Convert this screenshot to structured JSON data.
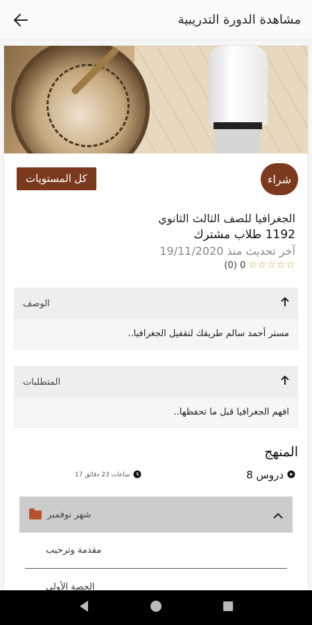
{
  "appbar": {
    "title": "مشاهدة الدورة التدريبية",
    "back_icon": "arrow-left-icon"
  },
  "course": {
    "levels_label": "كل المستويات",
    "buy_label": "شراء",
    "title": "الجغرافيا للصف الثالث الثانوي",
    "students": "1192 طلاب مشترك",
    "updated": "آخر تحديث منذ 19/11/2020",
    "rating_text": "0 (0)",
    "stars": "☆☆☆☆☆"
  },
  "description": {
    "label": "الوصف",
    "body": "مستر أحمد سالم طريقك لتقفيل الجغرافيا..",
    "icon": "arrow-up-icon"
  },
  "requirements": {
    "label": "المتطلبات",
    "body": "افهم الجغرافيا قبل ما تحفظها..",
    "icon": "arrow-up-icon"
  },
  "curriculum": {
    "title": "المنهج",
    "lessons": "8 دروس",
    "duration": "17 ساعات 23 دقائق",
    "section": {
      "title": "شهر نوفمبر",
      "icon": "folder-icon",
      "items": [
        "مقدمة وترحيب",
        "الحصة الأولى"
      ]
    }
  },
  "colors": {
    "accent": "#7b3a1e",
    "folder": "#b8522e"
  },
  "navbar": {
    "back": "nav-back-icon",
    "home": "nav-home-icon",
    "recents": "nav-recents-icon"
  }
}
